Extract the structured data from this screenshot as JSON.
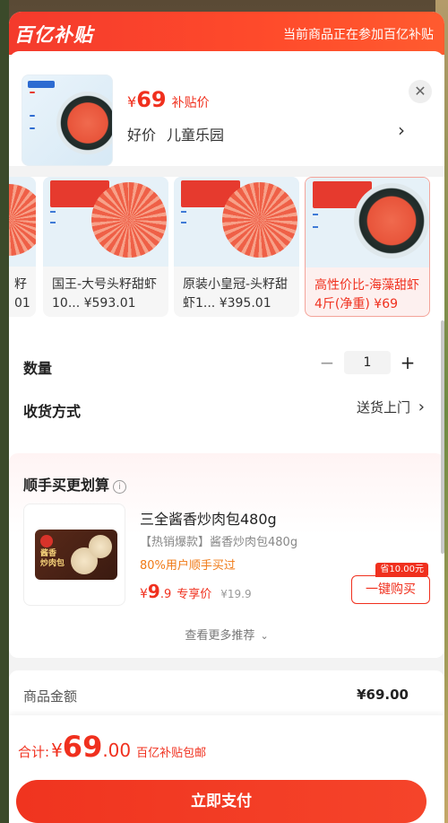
{
  "banner": {
    "brand": "百亿补贴",
    "notice": "当前商品正在参加百亿补贴"
  },
  "product": {
    "price_symbol": "¥",
    "price": "69",
    "price_tag": "补贴价",
    "tag1": "好价",
    "tag2": "儿童乐园"
  },
  "variants": [
    {
      "name": "籽\n01",
      "selected": false
    },
    {
      "name": "国王-大号头籽甜虾10... ¥593.01",
      "selected": false
    },
    {
      "name": "原装小皇冠-头籽甜虾1... ¥395.01",
      "selected": false
    },
    {
      "name": "高性价比-海藻甜虾4斤(净重) ¥69",
      "selected": true
    }
  ],
  "quantity": {
    "label": "数量",
    "minus": "−",
    "value": "1",
    "plus": "+"
  },
  "delivery": {
    "label": "收货方式",
    "value": "送货上门"
  },
  "recommend": {
    "title": "顺手买更划算",
    "item": {
      "name": "三全酱香炒肉包480g",
      "desc": "【热销爆款】酱香炒肉包480g",
      "promo": "80%用户顺手买过",
      "price_symbol": "¥",
      "price_int": "9",
      "price_dec": ".9",
      "price_label": "专享价",
      "old_price": "¥19.9",
      "save_badge": "省10.00元",
      "buy_label": "一键购买",
      "pack_text": "酱香\n炒肉包"
    },
    "more": "查看更多推荐"
  },
  "summary": {
    "label": "商品金额",
    "value": "¥69.00"
  },
  "footer": {
    "total_label": "合计:",
    "symbol": "¥",
    "total_int": "69",
    "total_dec": ".00",
    "note": "百亿补贴包邮",
    "pay_label": "立即支付"
  },
  "colors": {
    "accent": "#f0301e",
    "promo": "#f07a17"
  }
}
